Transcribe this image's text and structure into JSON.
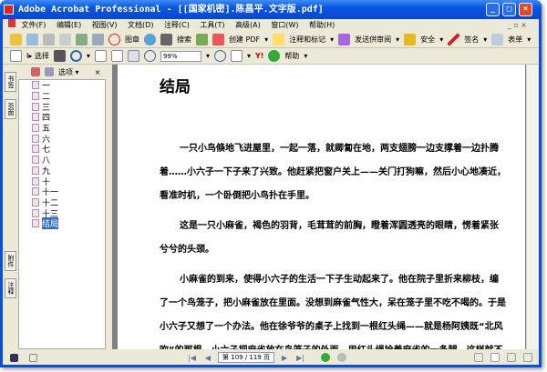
{
  "window": {
    "title": "Adobe Acrobat Professional - [[国家机密].陈昌平.文字版.pdf]"
  },
  "menu": [
    "文件(F)",
    "编辑(E)",
    "视图(V)",
    "文档(D)",
    "注释(C)",
    "工具(T)",
    "高级(A)",
    "窗口(W)",
    "帮助(H)"
  ],
  "toolbar1": {
    "stamp": "图章",
    "search": "搜索",
    "create_pdf": "创建 PDF",
    "comment": "注释和标记",
    "review": "发送供审阅",
    "security": "安全",
    "sign": "签名",
    "forms": "表单"
  },
  "toolbar2": {
    "select": "选择",
    "zoom": "99%",
    "help": "帮助"
  },
  "side_tabs": [
    "书签",
    "页面",
    "附件",
    "注释"
  ],
  "nav": {
    "options": "选项",
    "close": "×",
    "bookmarks": [
      "一",
      "二",
      "三",
      "四",
      "五",
      "六",
      "七",
      "八",
      "九",
      "十",
      "十一",
      "十二",
      "十三",
      "结局"
    ],
    "selected": "结局"
  },
  "page": {
    "heading": "结局",
    "paragraphs": [
      "一只小鸟倏地飞进屋里，一起一落，就卿匐在地，两支翅膀一边支撑着一边扑腾着……小六子一下子来了兴致。他赶紧把窗户关上——关门打狗嘛，然后小心地凑近，看准时机，一个卧倒把小鸟扑在手里。",
      "这是一只小麻雀，褐色的羽背，毛茸茸的前胸，瞪着浑圆透亮的眼睛，愣着紧张兮兮的头颈。",
      "小麻雀的到来，使得小六子的生活一下子生动起来了。他在院子里折来柳枝，编了一个鸟笼子，把小麻雀放在里面。没想到麻雀气性大，呆在笼子里不吃不喝的。于是小六子又想了一个办法。他在徐爷爷的桌子上找到一根红头绳——就是杨阿姨既“北风吹”的那根。小六子把麻雀放在鸟笼子的外面，用红头绳拴着麻雀的一条腿，这样就不"
    ]
  },
  "status": {
    "page_indicator": "第 109 / 119 页",
    "current_page": 109,
    "total_pages": 119
  }
}
